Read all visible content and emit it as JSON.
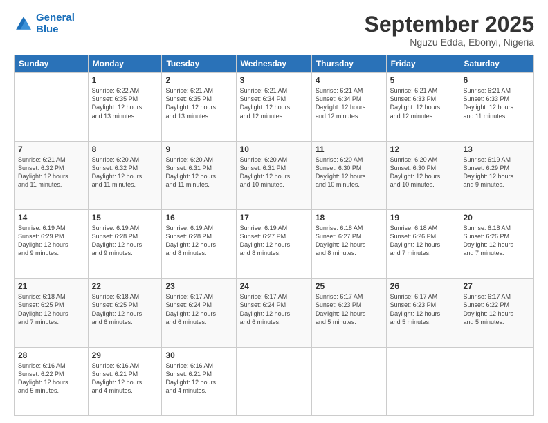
{
  "header": {
    "logo_line1": "General",
    "logo_line2": "Blue",
    "month": "September 2025",
    "location": "Nguzu Edda, Ebonyi, Nigeria"
  },
  "days_of_week": [
    "Sunday",
    "Monday",
    "Tuesday",
    "Wednesday",
    "Thursday",
    "Friday",
    "Saturday"
  ],
  "weeks": [
    [
      {
        "day": "",
        "info": ""
      },
      {
        "day": "1",
        "info": "Sunrise: 6:22 AM\nSunset: 6:35 PM\nDaylight: 12 hours\nand 13 minutes."
      },
      {
        "day": "2",
        "info": "Sunrise: 6:21 AM\nSunset: 6:35 PM\nDaylight: 12 hours\nand 13 minutes."
      },
      {
        "day": "3",
        "info": "Sunrise: 6:21 AM\nSunset: 6:34 PM\nDaylight: 12 hours\nand 12 minutes."
      },
      {
        "day": "4",
        "info": "Sunrise: 6:21 AM\nSunset: 6:34 PM\nDaylight: 12 hours\nand 12 minutes."
      },
      {
        "day": "5",
        "info": "Sunrise: 6:21 AM\nSunset: 6:33 PM\nDaylight: 12 hours\nand 12 minutes."
      },
      {
        "day": "6",
        "info": "Sunrise: 6:21 AM\nSunset: 6:33 PM\nDaylight: 12 hours\nand 11 minutes."
      }
    ],
    [
      {
        "day": "7",
        "info": "Sunrise: 6:21 AM\nSunset: 6:32 PM\nDaylight: 12 hours\nand 11 minutes."
      },
      {
        "day": "8",
        "info": "Sunrise: 6:20 AM\nSunset: 6:32 PM\nDaylight: 12 hours\nand 11 minutes."
      },
      {
        "day": "9",
        "info": "Sunrise: 6:20 AM\nSunset: 6:31 PM\nDaylight: 12 hours\nand 11 minutes."
      },
      {
        "day": "10",
        "info": "Sunrise: 6:20 AM\nSunset: 6:31 PM\nDaylight: 12 hours\nand 10 minutes."
      },
      {
        "day": "11",
        "info": "Sunrise: 6:20 AM\nSunset: 6:30 PM\nDaylight: 12 hours\nand 10 minutes."
      },
      {
        "day": "12",
        "info": "Sunrise: 6:20 AM\nSunset: 6:30 PM\nDaylight: 12 hours\nand 10 minutes."
      },
      {
        "day": "13",
        "info": "Sunrise: 6:19 AM\nSunset: 6:29 PM\nDaylight: 12 hours\nand 9 minutes."
      }
    ],
    [
      {
        "day": "14",
        "info": "Sunrise: 6:19 AM\nSunset: 6:29 PM\nDaylight: 12 hours\nand 9 minutes."
      },
      {
        "day": "15",
        "info": "Sunrise: 6:19 AM\nSunset: 6:28 PM\nDaylight: 12 hours\nand 9 minutes."
      },
      {
        "day": "16",
        "info": "Sunrise: 6:19 AM\nSunset: 6:28 PM\nDaylight: 12 hours\nand 8 minutes."
      },
      {
        "day": "17",
        "info": "Sunrise: 6:19 AM\nSunset: 6:27 PM\nDaylight: 12 hours\nand 8 minutes."
      },
      {
        "day": "18",
        "info": "Sunrise: 6:18 AM\nSunset: 6:27 PM\nDaylight: 12 hours\nand 8 minutes."
      },
      {
        "day": "19",
        "info": "Sunrise: 6:18 AM\nSunset: 6:26 PM\nDaylight: 12 hours\nand 7 minutes."
      },
      {
        "day": "20",
        "info": "Sunrise: 6:18 AM\nSunset: 6:26 PM\nDaylight: 12 hours\nand 7 minutes."
      }
    ],
    [
      {
        "day": "21",
        "info": "Sunrise: 6:18 AM\nSunset: 6:25 PM\nDaylight: 12 hours\nand 7 minutes."
      },
      {
        "day": "22",
        "info": "Sunrise: 6:18 AM\nSunset: 6:25 PM\nDaylight: 12 hours\nand 6 minutes."
      },
      {
        "day": "23",
        "info": "Sunrise: 6:17 AM\nSunset: 6:24 PM\nDaylight: 12 hours\nand 6 minutes."
      },
      {
        "day": "24",
        "info": "Sunrise: 6:17 AM\nSunset: 6:24 PM\nDaylight: 12 hours\nand 6 minutes."
      },
      {
        "day": "25",
        "info": "Sunrise: 6:17 AM\nSunset: 6:23 PM\nDaylight: 12 hours\nand 5 minutes."
      },
      {
        "day": "26",
        "info": "Sunrise: 6:17 AM\nSunset: 6:23 PM\nDaylight: 12 hours\nand 5 minutes."
      },
      {
        "day": "27",
        "info": "Sunrise: 6:17 AM\nSunset: 6:22 PM\nDaylight: 12 hours\nand 5 minutes."
      }
    ],
    [
      {
        "day": "28",
        "info": "Sunrise: 6:16 AM\nSunset: 6:22 PM\nDaylight: 12 hours\nand 5 minutes."
      },
      {
        "day": "29",
        "info": "Sunrise: 6:16 AM\nSunset: 6:21 PM\nDaylight: 12 hours\nand 4 minutes."
      },
      {
        "day": "30",
        "info": "Sunrise: 6:16 AM\nSunset: 6:21 PM\nDaylight: 12 hours\nand 4 minutes."
      },
      {
        "day": "",
        "info": ""
      },
      {
        "day": "",
        "info": ""
      },
      {
        "day": "",
        "info": ""
      },
      {
        "day": "",
        "info": ""
      }
    ]
  ]
}
